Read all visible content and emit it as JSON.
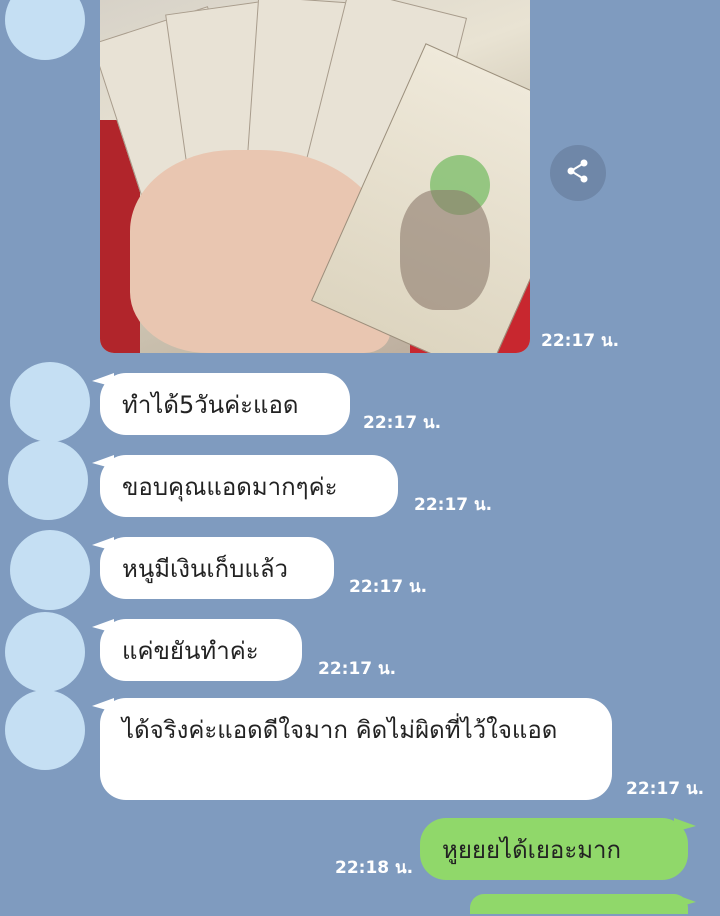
{
  "chat": {
    "photo_time": "22:17 น.",
    "messages": [
      {
        "text": "ทำได้5วันค่ะแอด",
        "time": "22:17 น."
      },
      {
        "text": "ขอบคุณแอดมากๆค่ะ",
        "time": "22:17 น."
      },
      {
        "text": "หนูมีเงินเก็บแล้ว",
        "time": "22:17 น."
      },
      {
        "text": "แค่ขยันทำค่ะ",
        "time": "22:17 น."
      },
      {
        "text": "ได้จริงค่ะแอดดีใจมาก คิดไม่ผิดที่ไว้ใจแอด",
        "time": "22:17 น."
      }
    ],
    "outgoing": [
      {
        "text": "หูยยยได้เยอะมาก",
        "time": "22:18 น."
      }
    ]
  },
  "icons": {
    "share": "share-icon"
  },
  "colors": {
    "background": "#7f9bbf",
    "incoming_bubble": "#ffffff",
    "outgoing_bubble": "#90d86a",
    "avatar_placeholder": "#c5dff3"
  }
}
